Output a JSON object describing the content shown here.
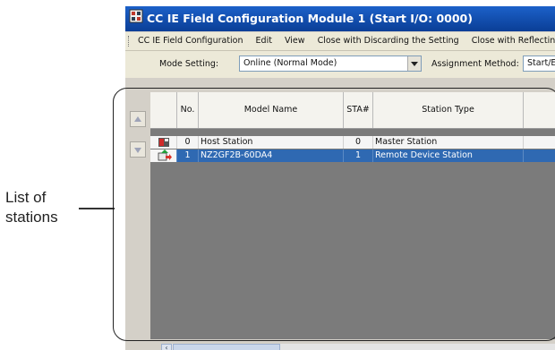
{
  "annotation": {
    "callout_lines": [
      "List of",
      "stations"
    ]
  },
  "window": {
    "title": "CC IE Field Configuration Module 1 (Start I/O: 0000)",
    "title_icon": "network-config-icon",
    "menu": [
      "CC IE Field Configuration",
      "Edit",
      "View",
      "Close with Discarding the Setting",
      "Close with Reflecting the Setting"
    ]
  },
  "toolbar": {
    "mode_label": "Mode Setting:",
    "mode_value": "Online (Normal Mode)",
    "assignment_label": "Assignment Method:",
    "assignment_value": "Start/End"
  },
  "table": {
    "columns": [
      "",
      "No.",
      "Model Name",
      "STA#",
      "Station Type"
    ],
    "rows": [
      {
        "icon": "host-station-icon",
        "no": "0",
        "model": "Host Station",
        "sta": "0",
        "type": "Master Station",
        "selected": false
      },
      {
        "icon": "remote-device-icon",
        "no": "1",
        "model": "NZ2GF2B-60DA4",
        "sta": "1",
        "type": "Remote Device Station",
        "selected": true
      }
    ]
  },
  "colors": {
    "title_bar": "#0a3e96",
    "selected_row": "#2f69b2",
    "empty_grid": "#7b7b7b"
  }
}
